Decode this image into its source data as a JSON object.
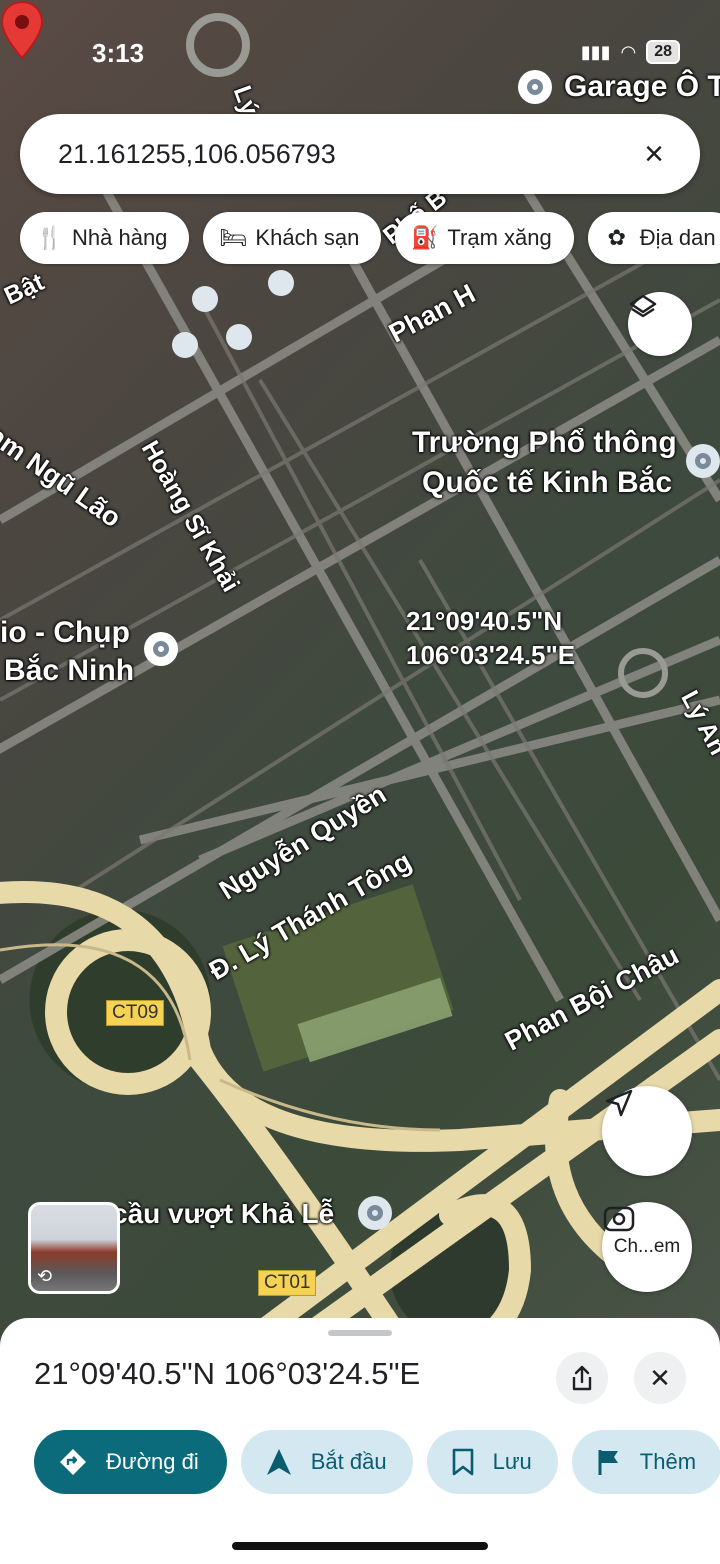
{
  "status_bar": {
    "time": "3:13",
    "battery": "28"
  },
  "search": {
    "value": "21.161255,106.056793"
  },
  "chips": [
    {
      "icon": "restaurant-icon",
      "label": "Nhà hàng"
    },
    {
      "icon": "hotel-icon",
      "label": "Khách sạn"
    },
    {
      "icon": "gas-station-icon",
      "label": "Trạm xăng"
    },
    {
      "icon": "attractions-icon",
      "label": "Địa dan"
    }
  ],
  "map": {
    "pin_label_lat": "21°09'40.5\"N",
    "pin_label_lng": "106°03'24.5\"E",
    "labels": {
      "garage": "Garage Ô T",
      "school_line1": "Trường Phổ thông",
      "school_line2": "Quốc tế Kinh Bắc",
      "studio_line1": "io - Chụp",
      "studio_line2": "Bắc Ninh",
      "phan_boi_chau": "Phan Bội Châu",
      "nguyen_quyen": "Nguyễn Quyền",
      "ly_thanh_tong": "Đ. Lý Thánh Tông",
      "hoang_si_khai": "Hoàng Sĩ Khải",
      "ngu_lao": "am Ngũ Lão",
      "bat": "Bật",
      "phan_h": "Phan H",
      "pho_b": "Phố B",
      "ly": "Lý",
      "ly_an": "Lý An",
      "cau_vuot": "cầu vượt Khả Lễ"
    },
    "shields": {
      "ct09": "CT09",
      "ct01": "CT01"
    }
  },
  "lens_button": {
    "label": "Ch...em"
  },
  "sheet": {
    "title": "21°09'40.5\"N 106°03'24.5\"E",
    "actions": [
      {
        "icon": "directions-icon",
        "label": "Đường đi"
      },
      {
        "icon": "navigation-icon",
        "label": "Bắt đầu"
      },
      {
        "icon": "bookmark-icon",
        "label": "Lưu"
      },
      {
        "icon": "flag-icon",
        "label": "Thêm"
      }
    ]
  },
  "colors": {
    "accent": "#0b6b7b",
    "secondary": "#d3e8f0",
    "pin": "#e53935",
    "highway": "#e8d9a8"
  }
}
